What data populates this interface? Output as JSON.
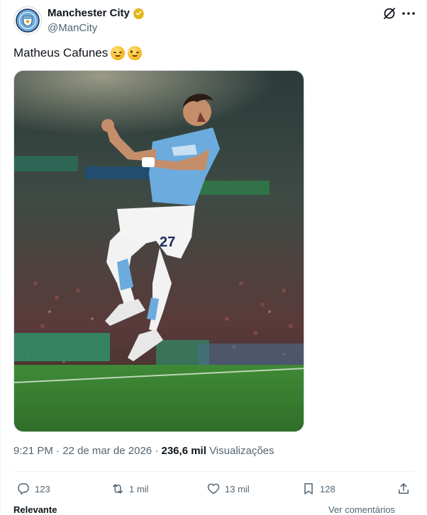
{
  "account": {
    "display_name": "Manchester City",
    "handle": "@ManCity"
  },
  "tweet": {
    "text": "Matheus Cafunes",
    "emojis": [
      "relieved-face",
      "winking-face"
    ]
  },
  "media": {
    "shirt_number": "27",
    "description_icon": "photo"
  },
  "meta": {
    "time": "9:21 PM",
    "separator": "·",
    "date": "22 de mar de 2026",
    "views_count": "236,6 mil",
    "views_label": "Visualizações"
  },
  "actions": {
    "replies": "123",
    "reposts": "1 mil",
    "likes": "13 mil",
    "bookmarks": "128"
  },
  "footer": {
    "left": "Relevante",
    "right": "Ver comentários"
  },
  "colors": {
    "text": "#0f1419",
    "muted": "#536471",
    "verified": "#e2b719",
    "city_blue": "#6cabdd"
  }
}
